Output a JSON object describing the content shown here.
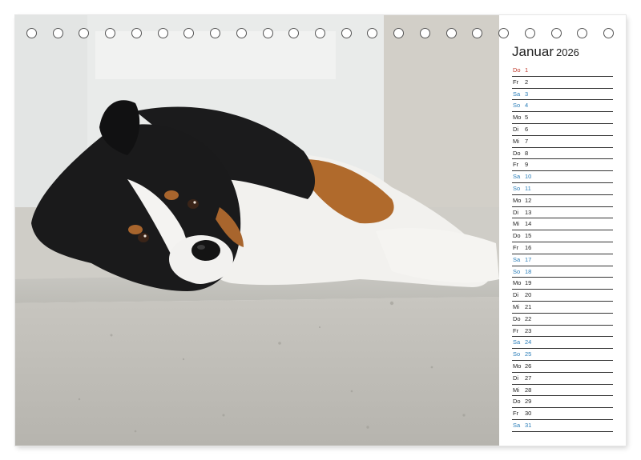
{
  "calendar": {
    "month": "Januar",
    "year": "2026",
    "days": [
      {
        "wd": "Do",
        "d": "1",
        "type": "holiday"
      },
      {
        "wd": "Fr",
        "d": "2",
        "type": "weekday"
      },
      {
        "wd": "Sa",
        "d": "3",
        "type": "sat"
      },
      {
        "wd": "So",
        "d": "4",
        "type": "sun"
      },
      {
        "wd": "Mo",
        "d": "5",
        "type": "weekday"
      },
      {
        "wd": "Di",
        "d": "6",
        "type": "weekday"
      },
      {
        "wd": "Mi",
        "d": "7",
        "type": "weekday"
      },
      {
        "wd": "Do",
        "d": "8",
        "type": "weekday"
      },
      {
        "wd": "Fr",
        "d": "9",
        "type": "weekday"
      },
      {
        "wd": "Sa",
        "d": "10",
        "type": "sat"
      },
      {
        "wd": "So",
        "d": "11",
        "type": "sun"
      },
      {
        "wd": "Mo",
        "d": "12",
        "type": "weekday"
      },
      {
        "wd": "Di",
        "d": "13",
        "type": "weekday"
      },
      {
        "wd": "Mi",
        "d": "14",
        "type": "weekday"
      },
      {
        "wd": "Do",
        "d": "15",
        "type": "weekday"
      },
      {
        "wd": "Fr",
        "d": "16",
        "type": "weekday"
      },
      {
        "wd": "Sa",
        "d": "17",
        "type": "sat"
      },
      {
        "wd": "So",
        "d": "18",
        "type": "sun"
      },
      {
        "wd": "Mo",
        "d": "19",
        "type": "weekday"
      },
      {
        "wd": "Di",
        "d": "20",
        "type": "weekday"
      },
      {
        "wd": "Mi",
        "d": "21",
        "type": "weekday"
      },
      {
        "wd": "Do",
        "d": "22",
        "type": "weekday"
      },
      {
        "wd": "Fr",
        "d": "23",
        "type": "weekday"
      },
      {
        "wd": "Sa",
        "d": "24",
        "type": "sat"
      },
      {
        "wd": "So",
        "d": "25",
        "type": "sun"
      },
      {
        "wd": "Mo",
        "d": "26",
        "type": "weekday"
      },
      {
        "wd": "Di",
        "d": "27",
        "type": "weekday"
      },
      {
        "wd": "Mi",
        "d": "28",
        "type": "weekday"
      },
      {
        "wd": "Do",
        "d": "29",
        "type": "weekday"
      },
      {
        "wd": "Fr",
        "d": "30",
        "type": "weekday"
      },
      {
        "wd": "Sa",
        "d": "31",
        "type": "sat"
      }
    ]
  },
  "photo": {
    "subject": "tricolor-dog-lying-on-concrete-step-photo"
  },
  "binding": {
    "ring_count": 23,
    "icon": "binding-ring-icon"
  },
  "colors": {
    "weekend": "#2a7db8",
    "holiday": "#c0392b",
    "text": "#222222"
  }
}
